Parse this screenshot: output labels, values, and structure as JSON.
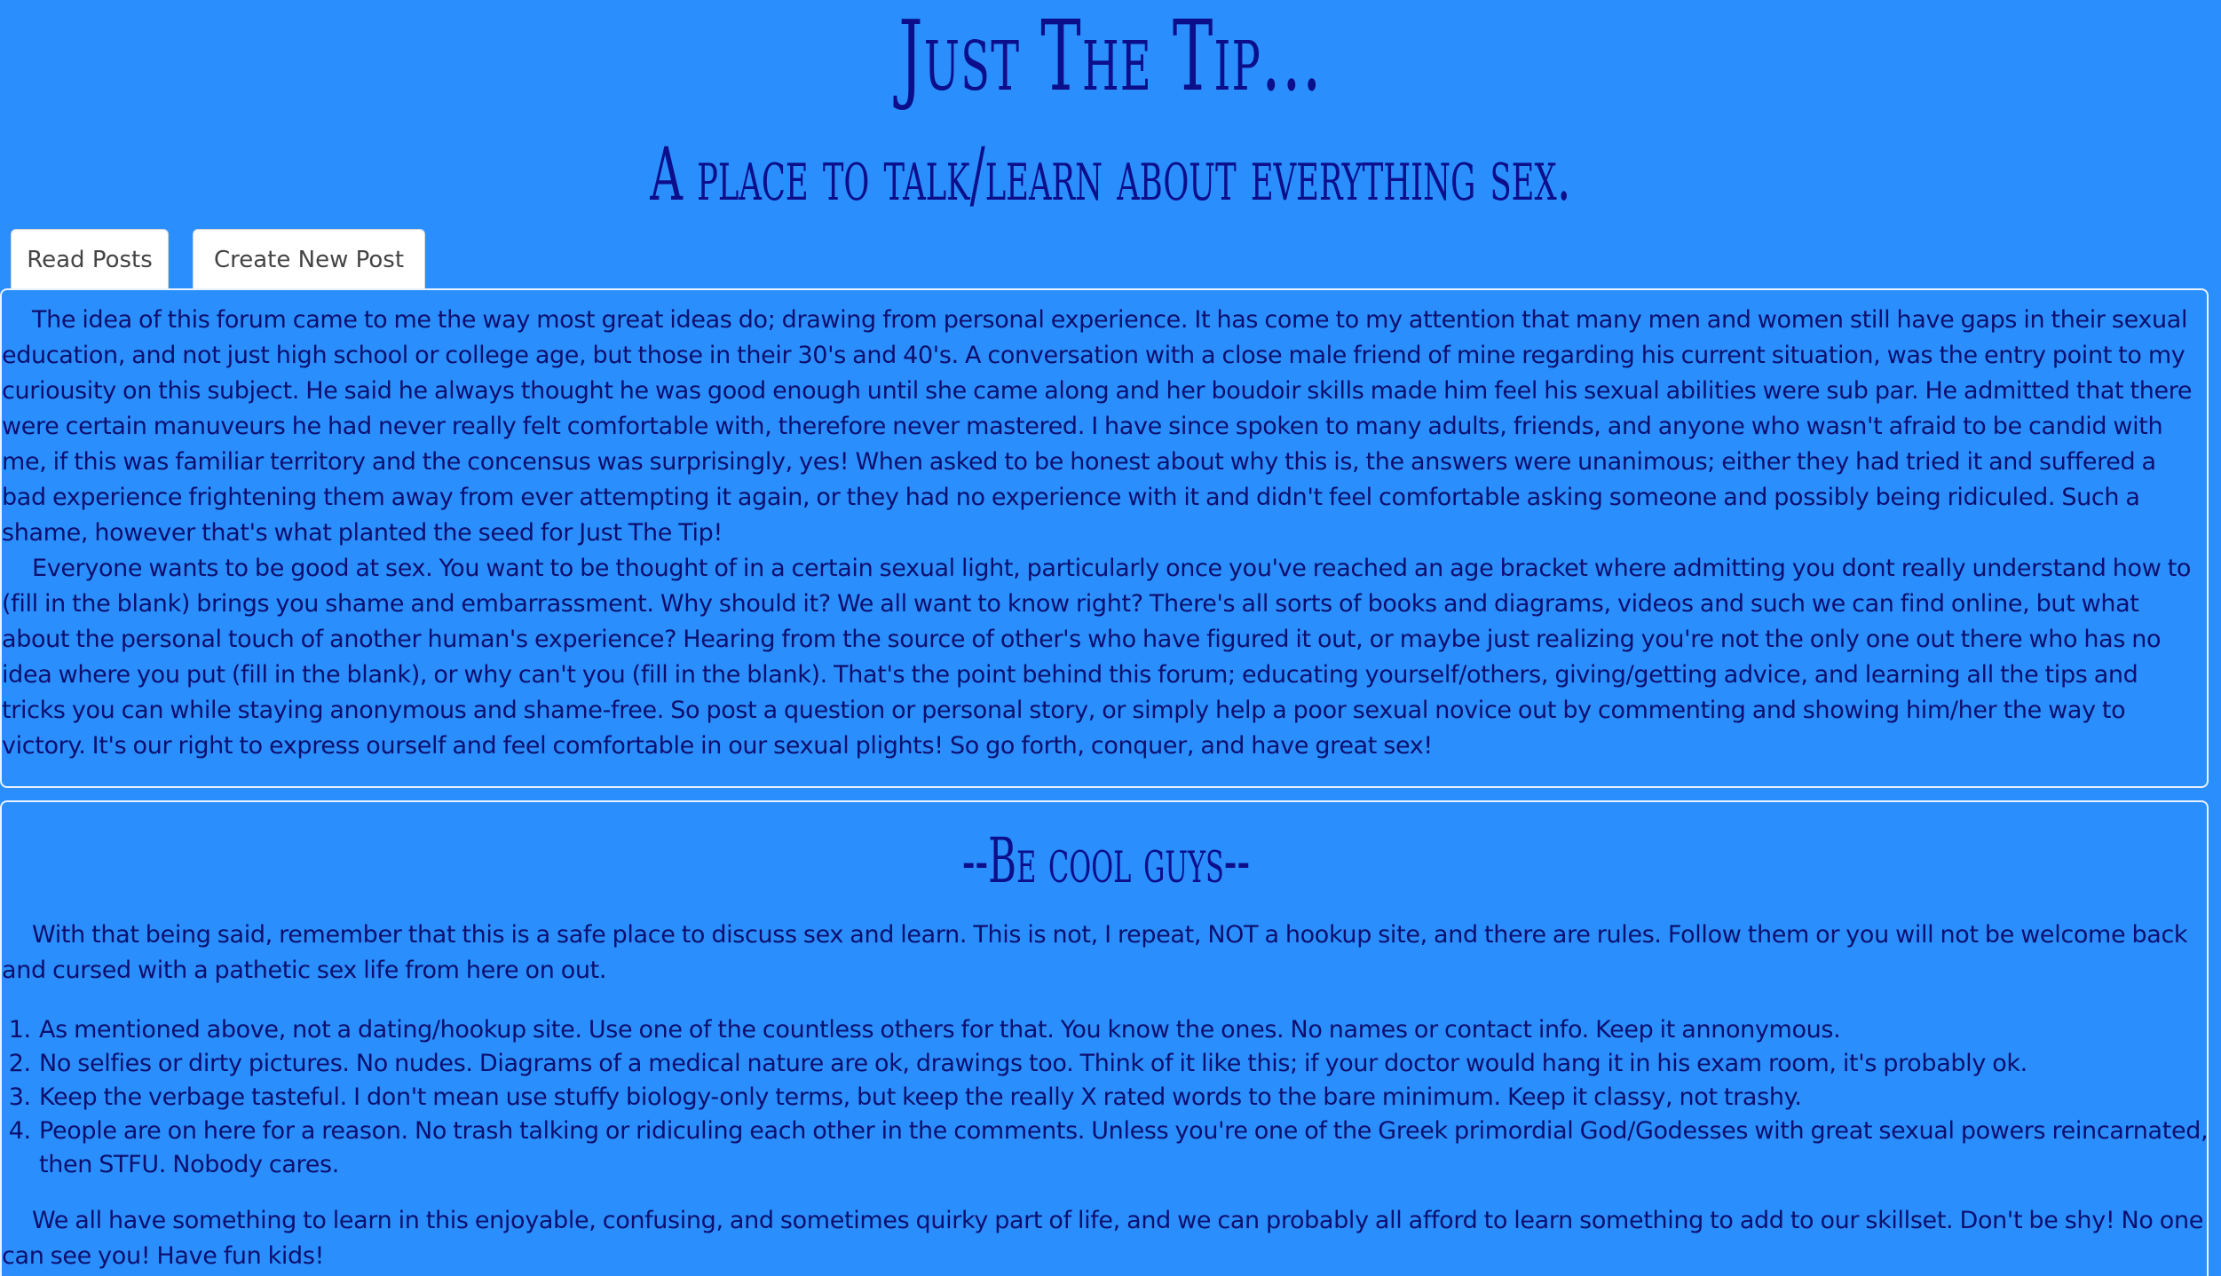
{
  "header": {
    "title": "Just The Tip...",
    "subtitle": "A place to talk/learn about everything sex."
  },
  "tabs": [
    {
      "label": "Read Posts"
    },
    {
      "label": "Create New Post"
    }
  ],
  "intro": {
    "paragraphs": [
      "The idea of this forum came to me the way most great ideas do; drawing from personal experience. It has come to my attention that many men and women still have gaps in their sexual education, and not just high school or college age, but those in their 30's and 40's. A conversation with a close male friend of mine regarding his current situation, was the entry point to my curiousity on this subject. He said he always thought he was good enough until she came along and her boudoir skills made him feel his sexual abilities were sub par. He admitted that there were certain manuveurs he had never really felt comfortable with, therefore never mastered. I have since spoken to many adults, friends, and anyone who wasn't afraid to be candid with me, if this was familiar territory and the concensus was surprisingly, yes! When asked to be honest about why this is, the answers were unanimous; either they had tried it and suffered a bad experience frightening them away from ever attempting it again, or they had no experience with it and didn't feel comfortable asking someone and possibly being ridiculed. Such a shame, however that's what planted the seed for Just The Tip!",
      "Everyone wants to be good at sex. You want to be thought of in a certain sexual light, particularly once you've reached an age bracket where admitting you dont really understand how to (fill in the blank) brings you shame and embarrassment. Why should it? We all want to know right? There's all sorts of books and diagrams, videos and such we can find online, but what about the personal touch of another human's experience? Hearing from the source of other's who have figured it out, or maybe just realizing you're not the only one out there who has no idea where you put (fill in the blank), or why can't you (fill in the blank). That's the point behind this forum; educating yourself/others, giving/getting advice, and learning all the tips and tricks you can while staying anonymous and shame-free. So post a question or personal story, or simply help a poor sexual novice out by commenting and showing him/her the way to victory. It's our right to express ourself and feel comfortable in our sexual plights! So go forth, conquer, and have great sex!"
    ]
  },
  "rules": {
    "heading": "--Be cool guys--",
    "intro": "With that being said, remember that this is a safe place to discuss sex and learn. This is not, I repeat, NOT a hookup site, and there are rules. Follow them or you will not be welcome back and cursed with a pathetic sex life from here on out.",
    "items": [
      "As mentioned above, not a dating/hookup site. Use one of the countless others for that. You know the ones. No names or contact info. Keep it annonymous.",
      "No selfies or dirty pictures. No nudes. Diagrams of a medical nature are ok, drawings too. Think of it like this; if your doctor would hang it in his exam room, it's probably ok.",
      "Keep the verbage tasteful. I don't mean use stuffy biology-only terms, but keep the really X rated words to the bare minimum. Keep it classy, not trashy.",
      "People are on here for a reason. No trash talking or ridiculing each other in the comments. Unless you're one of the Greek primordial God/Godesses with great sexual powers reincarnated, then STFU. Nobody cares."
    ],
    "closing": "We all have something to learn in this enjoyable, confusing, and sometimes quirky part of life, and we can probably all afford to learn something to add to our skillset. Don't be shy! No one can see you! Have fun kids!"
  }
}
